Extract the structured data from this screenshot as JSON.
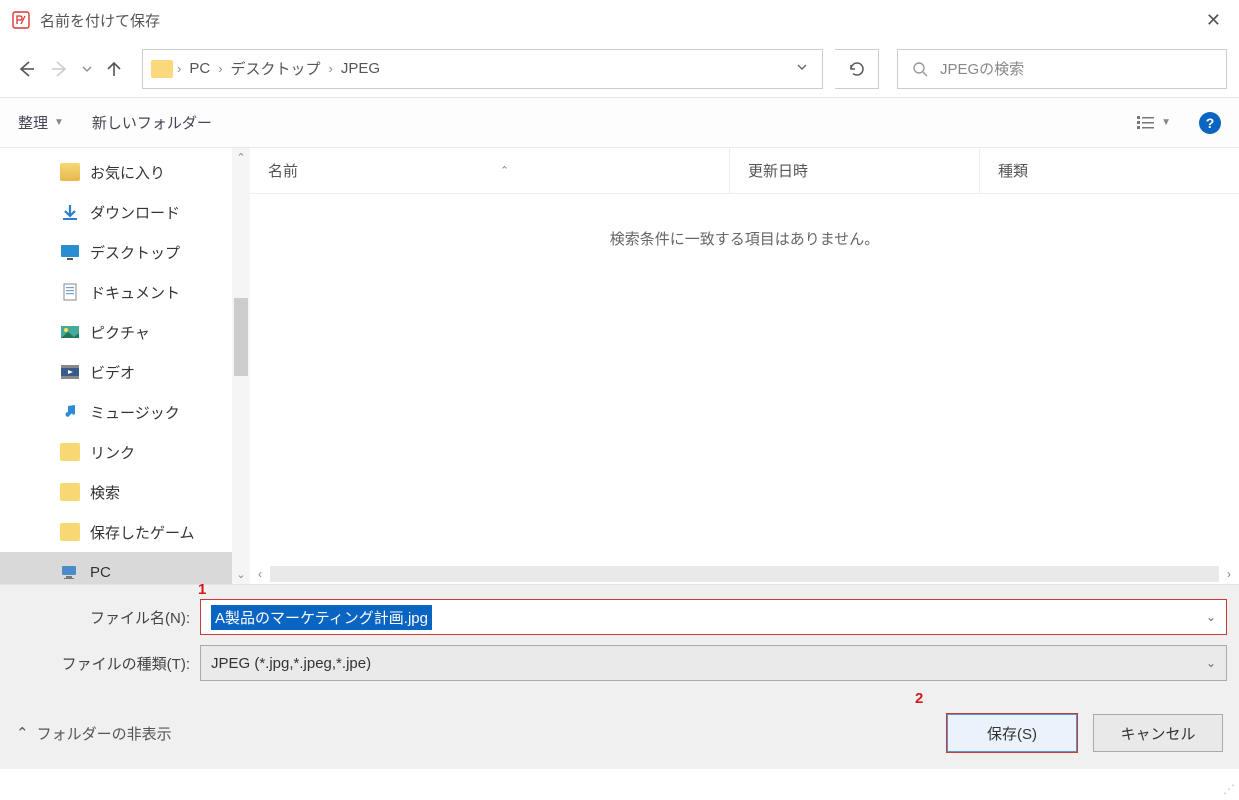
{
  "title": "名前を付けて保存",
  "breadcrumb": {
    "pc": "PC",
    "desktop": "デスクトップ",
    "jpeg": "JPEG"
  },
  "search": {
    "placeholder": "JPEGの検索"
  },
  "toolbar": {
    "organize": "整理",
    "newfolder": "新しいフォルダー"
  },
  "columns": {
    "name": "名前",
    "date": "更新日時",
    "type": "種類"
  },
  "empty_message": "検索条件に一致する項目はありません。",
  "sidebar": {
    "items": [
      {
        "label": "お気に入り"
      },
      {
        "label": "ダウンロード"
      },
      {
        "label": "デスクトップ"
      },
      {
        "label": "ドキュメント"
      },
      {
        "label": "ピクチャ"
      },
      {
        "label": "ビデオ"
      },
      {
        "label": "ミュージック"
      },
      {
        "label": "リンク"
      },
      {
        "label": "検索"
      },
      {
        "label": "保存したゲーム"
      },
      {
        "label": "PC"
      }
    ]
  },
  "filename_label": "ファイル名(N):",
  "filetype_label": "ファイルの種類(T):",
  "filename_value": "A製品のマーケティング計画.jpg",
  "filetype_value": "JPEG (*.jpg,*.jpeg,*.jpe)",
  "hide_folders": "フォルダーの非表示",
  "save_btn": "保存(S)",
  "cancel_btn": "キャンセル",
  "annotation1": "1",
  "annotation2": "2"
}
